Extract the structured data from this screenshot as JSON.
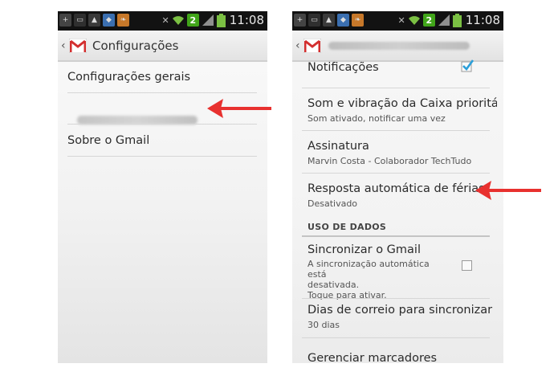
{
  "status_bar": {
    "time": "11:08",
    "badge": "2"
  },
  "left_screen": {
    "title": "Configurações",
    "items": [
      "Configurações gerais",
      "Sobre o Gmail"
    ]
  },
  "right_screen": {
    "notifications": {
      "label": "Notificações",
      "checked": true
    },
    "sound": {
      "label": "Som e vibração da Caixa prioritá",
      "summary": "Som ativado, notificar uma vez"
    },
    "signature": {
      "label": "Assinatura",
      "summary": "Marvin Costa - Colaborador TechTudo"
    },
    "vacation": {
      "label": "Resposta automática de férias",
      "summary": "Desativado"
    },
    "section_header": "USO DE DADOS",
    "sync": {
      "label": "Sincronizar o Gmail",
      "summary_line1": "A sincronização automática está",
      "summary_line2": "desativada.",
      "summary_line3": "Toque para ativar.",
      "checked": false
    },
    "days": {
      "label": "Dias de correio para sincronizar",
      "summary": "30 dias"
    },
    "labels": {
      "label": "Gerenciar marcadores"
    }
  },
  "colors": {
    "arrow": "#e8312f",
    "checkmark": "#2b9fd9",
    "status_bg": "#121212",
    "gmail_red": "#d32f2f"
  }
}
